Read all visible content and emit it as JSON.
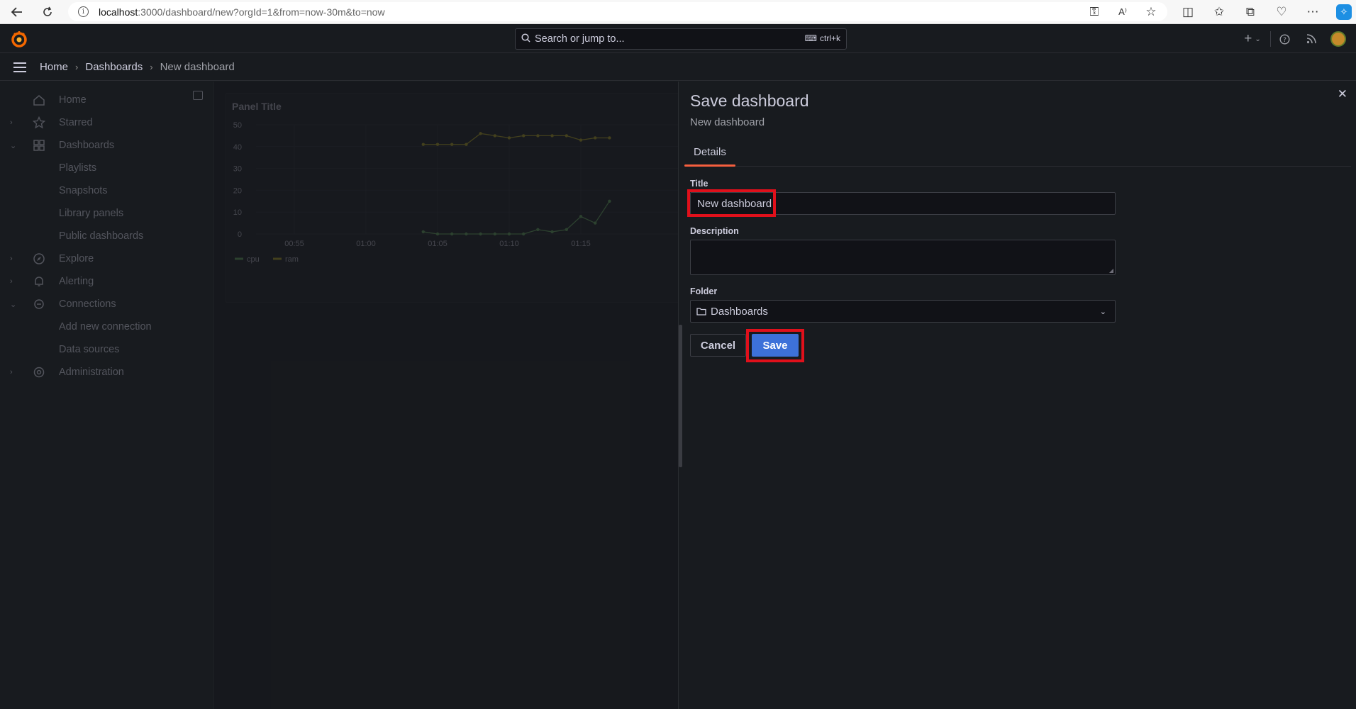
{
  "browser": {
    "url_host": "localhost",
    "url_path": ":3000/dashboard/new?orgId=1&from=now-30m&to=now"
  },
  "topbar": {
    "search_placeholder": "Search or jump to...",
    "search_shortcut": "ctrl+k"
  },
  "breadcrumb": [
    "Home",
    "Dashboards",
    "New dashboard"
  ],
  "sidebar": {
    "items": [
      {
        "label": "Home",
        "icon": "home-icon",
        "expand": ""
      },
      {
        "label": "Starred",
        "icon": "star-icon",
        "expand": "collapsed"
      },
      {
        "label": "Dashboards",
        "icon": "apps-icon",
        "expand": "expanded"
      },
      {
        "label": "Playlists",
        "icon": "",
        "expand": ""
      },
      {
        "label": "Snapshots",
        "icon": "",
        "expand": ""
      },
      {
        "label": "Library panels",
        "icon": "",
        "expand": ""
      },
      {
        "label": "Public dashboards",
        "icon": "",
        "expand": ""
      },
      {
        "label": "Explore",
        "icon": "compass-icon",
        "expand": "collapsed"
      },
      {
        "label": "Alerting",
        "icon": "bell-icon",
        "expand": "collapsed"
      },
      {
        "label": "Connections",
        "icon": "plug-icon",
        "expand": "expanded"
      },
      {
        "label": "Add new connection",
        "icon": "",
        "expand": ""
      },
      {
        "label": "Data sources",
        "icon": "",
        "expand": ""
      },
      {
        "label": "Administration",
        "icon": "cog-icon",
        "expand": "collapsed"
      }
    ]
  },
  "panel": {
    "title": "Panel Title"
  },
  "chart_data": {
    "type": "line",
    "title": "Panel Title",
    "x_ticks": [
      "00:55",
      "01:00",
      "01:05",
      "01:10",
      "01:15"
    ],
    "y_ticks": [
      0,
      10,
      20,
      30,
      40,
      50
    ],
    "ylim": [
      0,
      50
    ],
    "legend": "bottom-left",
    "series": [
      {
        "name": "cpu",
        "color": "#73bf69",
        "values": [
          1,
          0,
          0,
          0,
          0,
          0,
          0,
          0,
          2,
          1,
          2,
          8,
          5,
          15
        ]
      },
      {
        "name": "ram",
        "color": "#cabb22",
        "values": [
          41,
          41,
          41,
          41,
          46,
          45,
          44,
          45,
          45,
          45,
          45,
          43,
          44,
          44
        ]
      }
    ],
    "x_start_index_minutes": [
      "01:04",
      "01:17"
    ]
  },
  "drawer": {
    "title": "Save dashboard",
    "subtitle": "New dashboard",
    "tab": "Details",
    "title_label": "Title",
    "title_value": "New dashboard",
    "description_label": "Description",
    "description_value": "",
    "folder_label": "Folder",
    "folder_value": "Dashboards",
    "cancel": "Cancel",
    "save": "Save"
  },
  "colors": {
    "save_button": "#3d71d9",
    "tab_accent": "#f55f3e",
    "highlight": "#e0101b"
  }
}
